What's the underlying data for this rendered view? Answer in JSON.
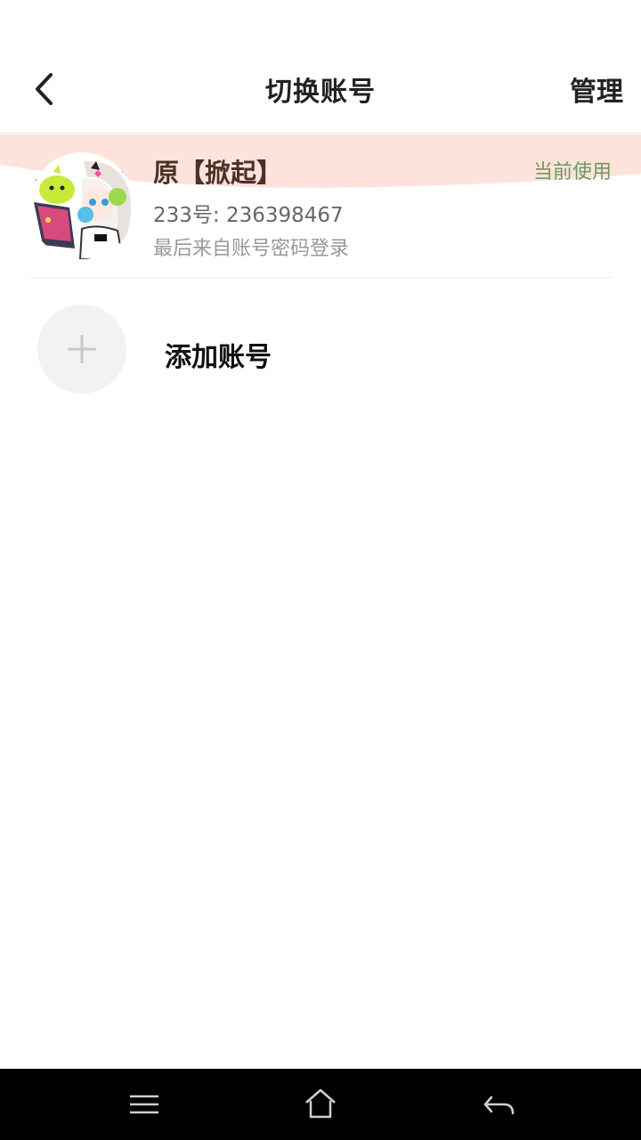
{
  "header": {
    "title": "切换账号",
    "manage_label": "管理"
  },
  "current_account": {
    "name": "原【掀起】",
    "uid_label": "233号: 236398467",
    "login_info": "最后来自账号密码登录",
    "badge": "当前使用"
  },
  "add_account": {
    "label": "添加账号"
  },
  "colors": {
    "accent_wave": "#fde3db",
    "badge_green": "#6d9a5c",
    "name_brown": "#4a3226"
  },
  "icons": {
    "back": "chevron-left-icon",
    "add": "plus-icon",
    "nav_menu": "menu-icon",
    "nav_home": "home-icon",
    "nav_back": "back-arrow-icon"
  }
}
